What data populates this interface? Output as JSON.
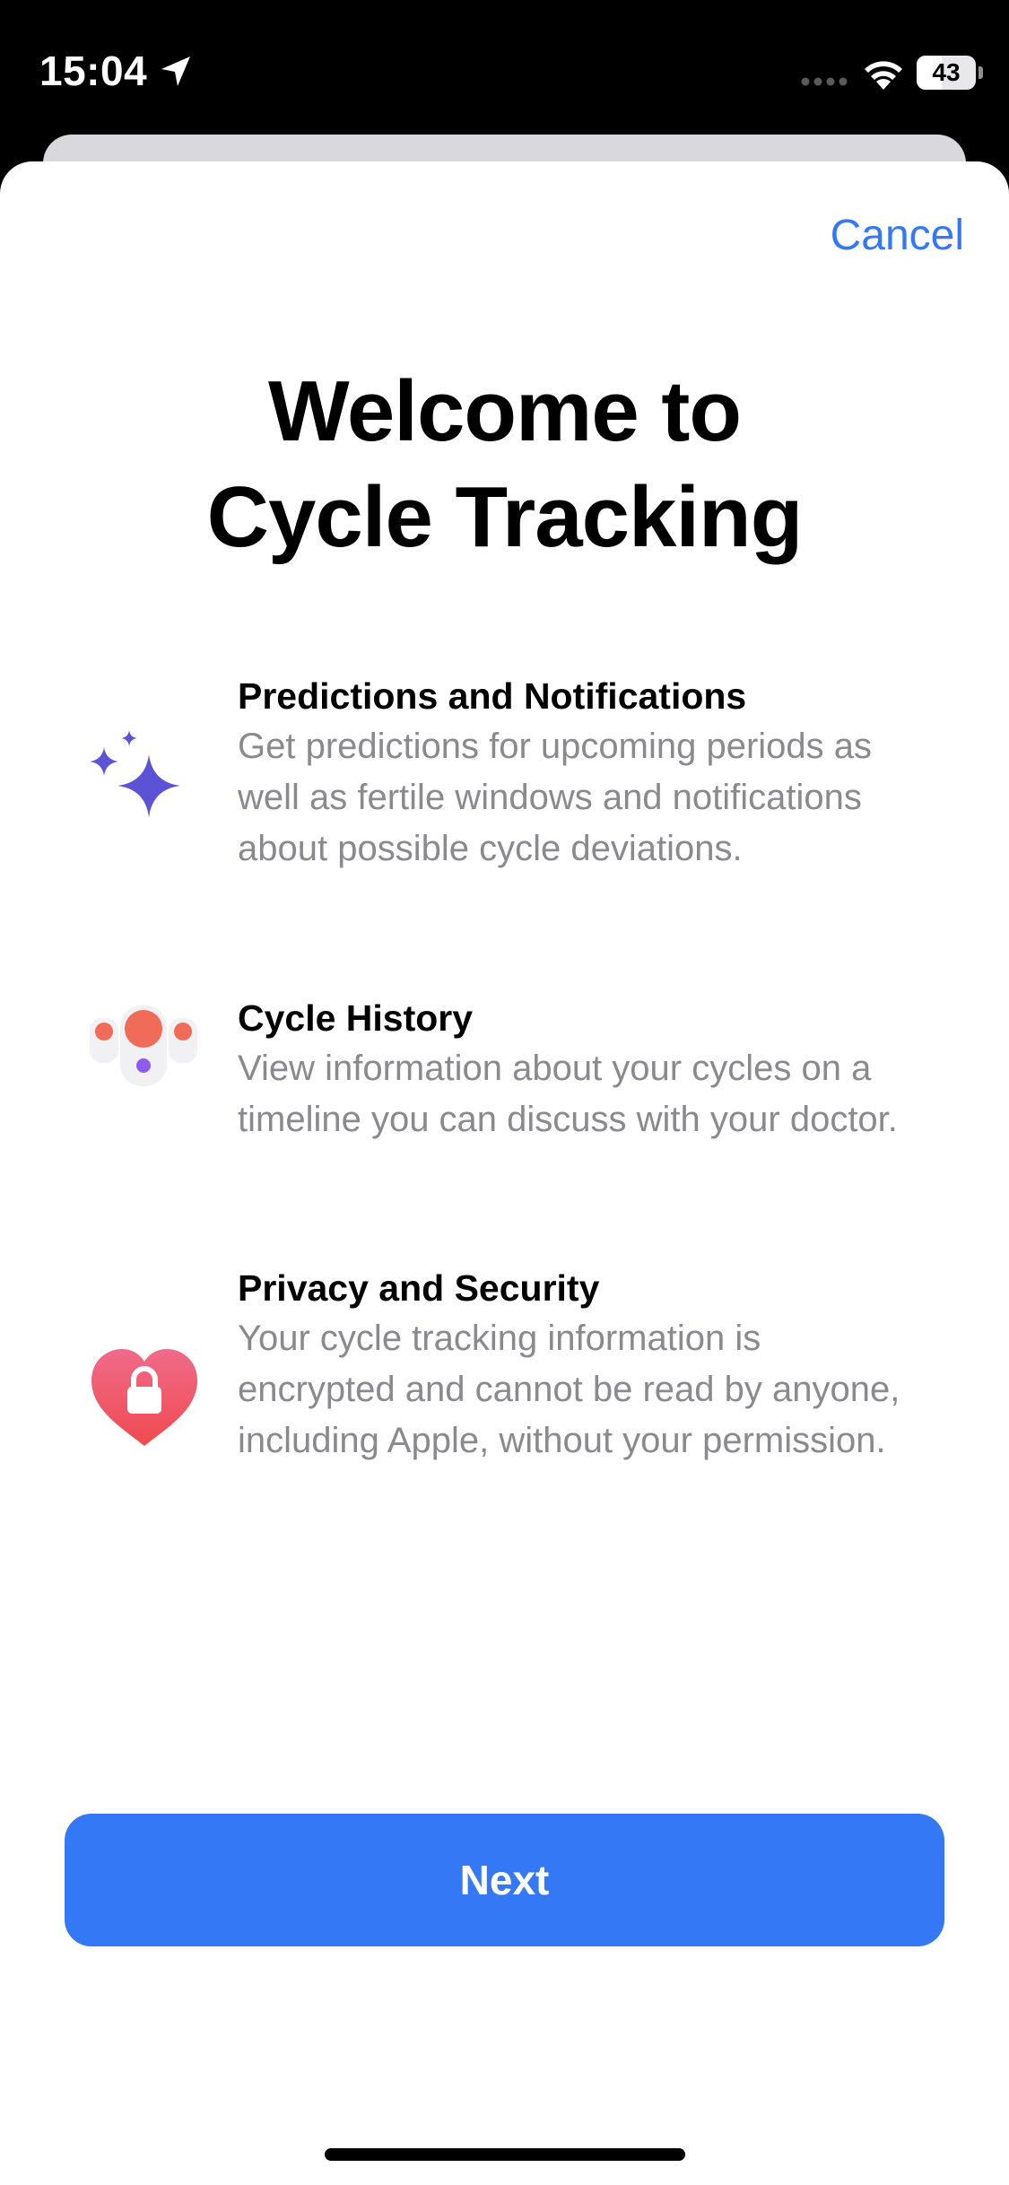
{
  "status_bar": {
    "time": "15:04",
    "battery_level": "43",
    "battery_fraction": 0.43
  },
  "header": {
    "cancel_label": "Cancel"
  },
  "title": {
    "line1": "Welcome to",
    "line2": "Cycle Tracking"
  },
  "features": [
    {
      "icon": "sparkles-icon",
      "title": "Predictions and Notifications",
      "description": "Get predictions for upcoming periods as well as fertile windows and notifications about possible cycle deviations."
    },
    {
      "icon": "cycle-history-icon",
      "title": "Cycle History",
      "description": "View information about your cycles on a timeline you can discuss with your doctor."
    },
    {
      "icon": "heart-lock-icon",
      "title": "Privacy and Security",
      "description": "Your cycle tracking information is encrypted and cannot be read by anyone, including Apple, without your permission."
    }
  ],
  "footer": {
    "next_label": "Next"
  },
  "colors": {
    "accent": "#3478f6",
    "sparkle": "#5b52d6",
    "period": "#f06b58",
    "fertile": "#8c5cf0",
    "heart_top": "#f06a8a",
    "heart_bottom": "#ef4a4e",
    "secondary_text": "#8a8a8e"
  }
}
